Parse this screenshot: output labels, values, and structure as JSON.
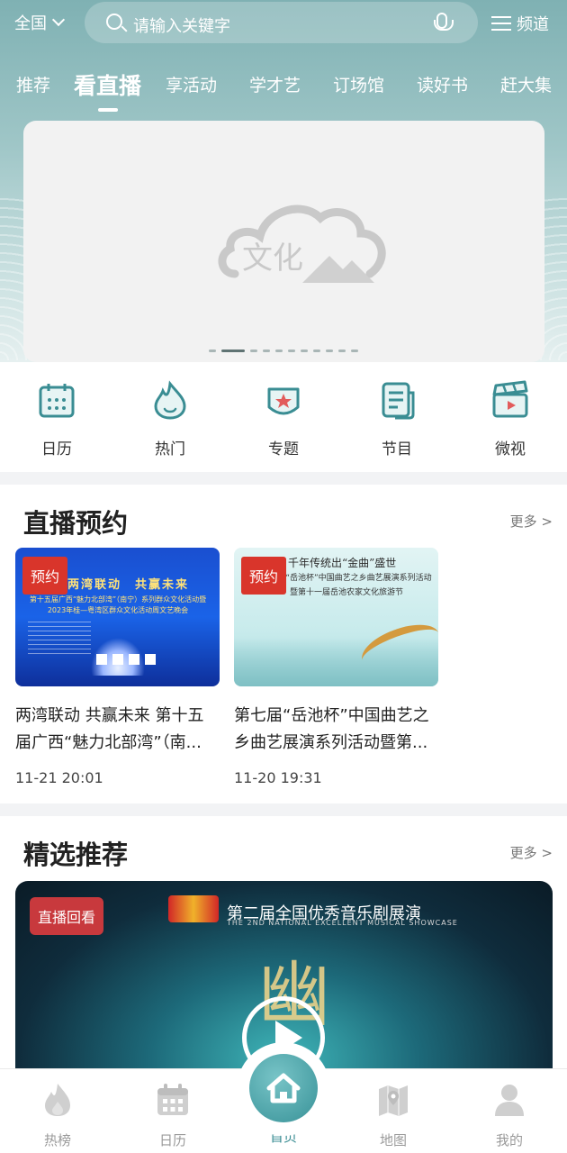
{
  "header": {
    "region": "全国",
    "search_placeholder": "请输入关键字",
    "channel_label": "频道"
  },
  "tabs": [
    {
      "label": "推荐",
      "active": false
    },
    {
      "label": "看直播",
      "active": true
    },
    {
      "label": "享活动",
      "active": false
    },
    {
      "label": "学才艺",
      "active": false
    },
    {
      "label": "订场馆",
      "active": false
    },
    {
      "label": "读好书",
      "active": false
    },
    {
      "label": "赶大集",
      "active": false
    }
  ],
  "banner": {
    "logo_text": "文化",
    "pager_count": 11,
    "pager_active": 1
  },
  "quick_links": [
    {
      "label": "日历",
      "icon": "calendar-icon"
    },
    {
      "label": "热门",
      "icon": "flame-icon"
    },
    {
      "label": "专题",
      "icon": "badge-star-icon"
    },
    {
      "label": "节目",
      "icon": "document-icon"
    },
    {
      "label": "微视",
      "icon": "clapperboard-icon"
    }
  ],
  "live_booking": {
    "title": "直播预约",
    "more": "更多 >",
    "cards": [
      {
        "tag": "预约",
        "title": "两湾联动 共赢未来 第十五届广西“魅力北部湾”（南...",
        "time": "11-21 20:01",
        "poster_headline": "两湾联动　共赢未来",
        "poster_sub": "第十五届广西“魅力北部湾”（南宁）系列群众文化活动暨2023年桂—粤湾区群众文化活动周文艺晚会"
      },
      {
        "tag": "预约",
        "title": "第七届“岳池杯”中国曲艺之乡曲艺展演系列活动暨第...",
        "time": "11-20 19:31",
        "poster_top": "千年传统出“金曲”盛世",
        "poster_line1": "第七届“岳池杯”中国曲艺之乡曲艺展演系列活动",
        "poster_line2": "暨第十一届岳池农家文化旅游节"
      }
    ]
  },
  "featured": {
    "title": "精选推荐",
    "more": "更多 >",
    "card": {
      "tag": "直播回看",
      "poster_title": "第二届全国优秀音乐剧展演",
      "poster_sub": "THE 2ND NATIONAL EXCELLENT MUSICAL SHOWCASE",
      "poster_art": "幽"
    }
  },
  "bottom_nav": [
    {
      "label": "热榜",
      "icon": "flame-icon",
      "active": false
    },
    {
      "label": "日历",
      "icon": "calendar-icon",
      "active": false
    },
    {
      "label": "首页",
      "icon": "home-icon",
      "active": true
    },
    {
      "label": "地图",
      "icon": "map-icon",
      "active": false
    },
    {
      "label": "我的",
      "icon": "user-icon",
      "active": false
    }
  ],
  "colors": {
    "accent": "#3a8d93",
    "tag_red": "#d9352b"
  }
}
